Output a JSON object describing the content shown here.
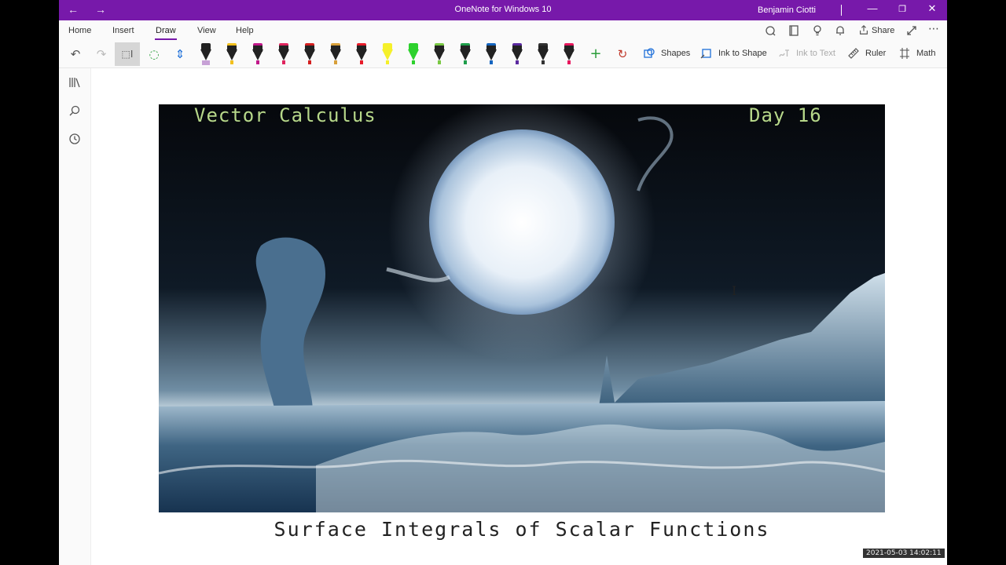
{
  "titlebar": {
    "title": "OneNote for Windows 10",
    "user": "Benjamin Ciotti",
    "back_icon": "←",
    "forward_icon": "→",
    "minimize": "—",
    "restore": "❐",
    "close": "✕"
  },
  "menu": {
    "tabs": [
      "Home",
      "Insert",
      "Draw",
      "View",
      "Help"
    ],
    "active": "Draw",
    "share_label": "Share"
  },
  "toolbar": {
    "shapes_label": "Shapes",
    "ink_to_shape_label": "Ink to Shape",
    "ink_to_text_label": "Ink to Text",
    "ruler_label": "Ruler",
    "math_label": "Math",
    "pens": [
      {
        "type": "highlighter-pen",
        "color": "#c7a1d6"
      },
      {
        "type": "pen",
        "color": "#f2c01e"
      },
      {
        "type": "pen",
        "color": "#c2188a"
      },
      {
        "type": "pen",
        "color": "#e0245e"
      },
      {
        "type": "pen",
        "color": "#d42020"
      },
      {
        "type": "pen",
        "color": "#d8a03a"
      },
      {
        "type": "pen",
        "color": "#e81c2a"
      },
      {
        "type": "highlighter",
        "color": "#f5f02a"
      },
      {
        "type": "highlighter",
        "color": "#2dd12d"
      },
      {
        "type": "pen",
        "color": "#7ac943"
      },
      {
        "type": "pen",
        "color": "#1e9e4a"
      },
      {
        "type": "pen",
        "color": "#1565c0"
      },
      {
        "type": "pen",
        "color": "#5b2aa0"
      },
      {
        "type": "pen",
        "color": "#333333"
      },
      {
        "type": "pen",
        "color": "#e8175d"
      }
    ]
  },
  "page": {
    "image_title_left": "Vector Calculus",
    "image_title_right": "Day 16",
    "subtitle": "Surface Integrals of Scalar Functions"
  },
  "overlay": {
    "timestamp": "2021-05-03 14:02:11"
  },
  "colors": {
    "accent": "#7719aa",
    "image_title": "#b7d88a"
  }
}
